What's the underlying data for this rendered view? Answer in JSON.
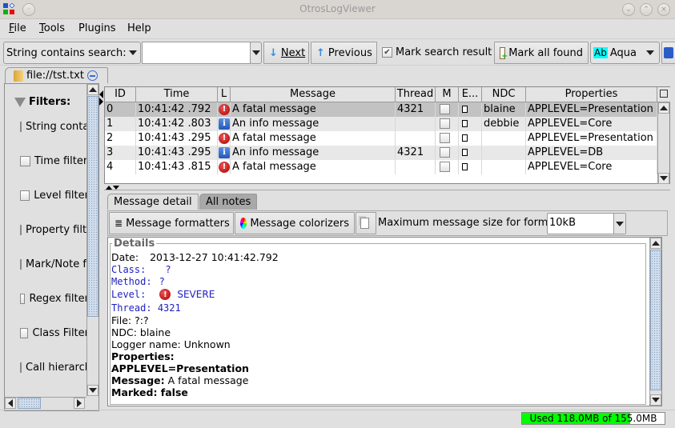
{
  "window": {
    "title": "OtrosLogViewer"
  },
  "menu": [
    {
      "label": "File",
      "mnemonic": "F",
      "rest": "ile"
    },
    {
      "label": "Tools",
      "mnemonic": "T",
      "rest": "ools"
    },
    {
      "label": "Plugins"
    },
    {
      "label": "Help"
    }
  ],
  "toolbar": {
    "search_mode": "String contains search:",
    "search_value": "",
    "next_label": "Next",
    "previous_label": "Previous",
    "mark_search_result_label": "Mark search result",
    "mark_search_result_checked": true,
    "mark_all_found_label": "Mark all found",
    "mark_color_sample": "Ab",
    "mark_color": "Aqua",
    "mark_color_hex": "#00ffff"
  },
  "file_tab": {
    "label": "file://tst.txt"
  },
  "filters": {
    "title": "Filters:",
    "items": [
      {
        "label": "String contains filter",
        "checked": false
      },
      {
        "label": "Time filter",
        "checked": false
      },
      {
        "label": "Level filter",
        "checked": false
      },
      {
        "label": "Property filter",
        "checked": false
      },
      {
        "label": "Mark/Note filter",
        "checked": false
      },
      {
        "label": "Regex filter",
        "checked": false
      },
      {
        "label": "Class Filter",
        "checked": false
      },
      {
        "label": "Call hierarchy",
        "checked": false
      }
    ]
  },
  "table": {
    "columns": [
      "ID",
      "Time",
      "L",
      "Message",
      "Thread",
      "M",
      "E...",
      "NDC",
      "Properties"
    ],
    "rows": [
      {
        "id": "0",
        "time": "10:41:42 .792",
        "level": "fatal",
        "message": "A fatal message",
        "thread": "4321",
        "marked": false,
        "ndc": "blaine",
        "properties": "APPLEVEL=Presentation"
      },
      {
        "id": "1",
        "time": "10:41:42 .803",
        "level": "info",
        "message": "An info message",
        "thread": "",
        "marked": false,
        "ndc": "debbie",
        "properties": "APPLEVEL=Core"
      },
      {
        "id": "2",
        "time": "10:41:43 .295",
        "level": "fatal",
        "message": "A fatal message",
        "thread": "",
        "marked": false,
        "ndc": "",
        "properties": "APPLEVEL=Presentation"
      },
      {
        "id": "3",
        "time": "10:41:43 .295",
        "level": "info",
        "message": "An info message",
        "thread": "4321",
        "marked": false,
        "ndc": "",
        "properties": "APPLEVEL=DB"
      },
      {
        "id": "4",
        "time": "10:41:43 .815",
        "level": "fatal",
        "message": "A fatal message",
        "thread": "",
        "marked": false,
        "ndc": "",
        "properties": "APPLEVEL=Core"
      }
    ],
    "selected_row": 0
  },
  "detail_tabs": [
    {
      "label": "Message detail",
      "active": true
    },
    {
      "label": "All notes",
      "active": false
    }
  ],
  "detail_toolbar": {
    "formatters_label": "Message formatters",
    "colorizers_label": "Message colorizers",
    "max_size_label": "Maximum message size for format",
    "max_size_value": "10kB"
  },
  "details": {
    "title": "Details",
    "date_label": "Date:",
    "date_value": "2013-12-27 10:41:42.792",
    "class_label": "Class:",
    "class_value": "?",
    "method_label": "Method:",
    "method_value": "?",
    "level_label": "Level:",
    "level_value": "SEVERE",
    "thread_label": "Thread:",
    "thread_value": "4321",
    "file_line": "File: ?:?",
    "ndc_line": "NDC: blaine",
    "logger_line": "Logger name: Unknown",
    "properties_label": "Properties:",
    "properties_value": "APPLEVEL=Presentation",
    "message_label": "Message:",
    "message_value": "A fatal message",
    "marked_line": "Marked: false"
  },
  "status": {
    "memory_text": "Used 118.0MB of 155.0MB",
    "memory_used_fraction": 0.761,
    "bar_color": "#00ff00"
  }
}
